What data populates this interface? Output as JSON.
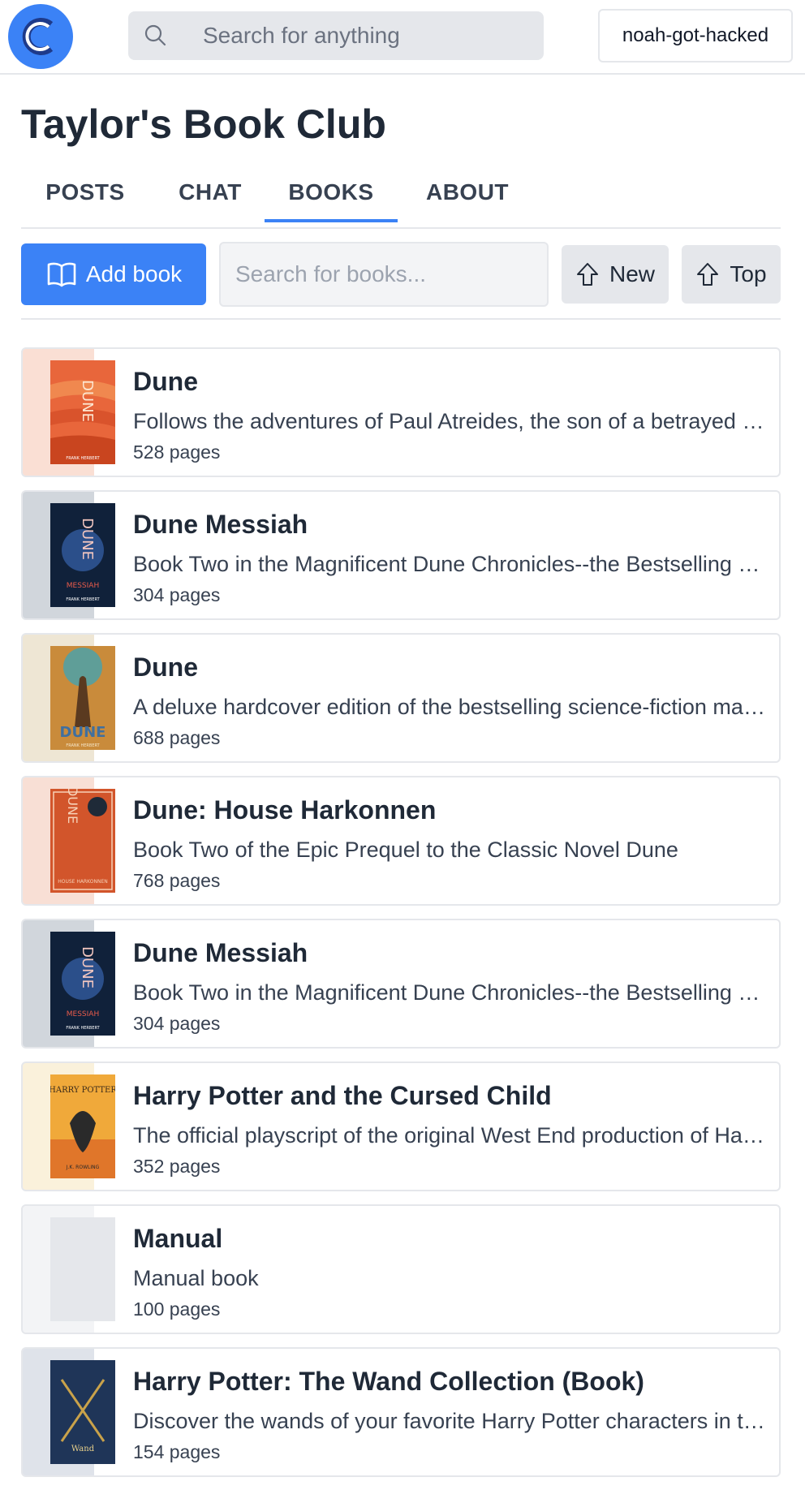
{
  "header": {
    "search_placeholder": "Search for anything",
    "username": "noah-got-hacked",
    "brand_color": "#3b82f6"
  },
  "club": {
    "title": "Taylor's Book Club"
  },
  "tabs": [
    {
      "label": "POSTS"
    },
    {
      "label": "CHAT"
    },
    {
      "label": "BOOKS",
      "active": true
    },
    {
      "label": "ABOUT"
    }
  ],
  "toolbar": {
    "add_label": "Add book",
    "search_placeholder": "Search for books...",
    "sort_new": "New",
    "sort_top": "Top"
  },
  "books": [
    {
      "title": "Dune",
      "description": "Follows the adventures of Paul Atreides, the son of a betrayed duke given up for dead on a treacherous desert planet",
      "pages": "528 pages",
      "cover_text": "DUNE",
      "cover_author": "FRANK HERBERT"
    },
    {
      "title": "Dune Messiah",
      "description": "Book Two in the Magnificent Dune Chronicles--the Bestselling Science Fiction Adventure of All Time",
      "pages": "304 pages",
      "cover_text": "DUNE",
      "cover_sub": "MESSIAH",
      "cover_author": "FRANK HERBERT"
    },
    {
      "title": "Dune",
      "description": "A deluxe hardcover edition of the bestselling science-fiction masterpiece",
      "pages": "688 pages",
      "cover_text": "DUNE",
      "cover_author": "FRANK HERBERT"
    },
    {
      "title": "Dune: House Harkonnen",
      "description": "Book Two of the Epic Prequel to the Classic Novel Dune",
      "pages": "768 pages",
      "cover_text": "DUNE",
      "cover_sub": "HOUSE HARKONNEN"
    },
    {
      "title": "Dune Messiah",
      "description": "Book Two in the Magnificent Dune Chronicles--the Bestselling Science Fiction Adventure of All Time",
      "pages": "304 pages",
      "cover_text": "DUNE",
      "cover_sub": "MESSIAH",
      "cover_author": "FRANK HERBERT"
    },
    {
      "title": "Harry Potter and the Cursed Child",
      "description": "The official playscript of the original West End production of Harry Potter and the Cursed Child",
      "pages": "352 pages",
      "cover_text": "HARRY POTTER",
      "cover_author": "J.K. ROWLING"
    },
    {
      "title": "Manual",
      "description": "Manual book",
      "pages": "100 pages"
    },
    {
      "title": "Harry Potter: The Wand Collection (Book)",
      "description": "Discover the wands of your favorite Harry Potter characters in this collection",
      "pages": "154 pages",
      "cover_text": "Wand"
    }
  ]
}
